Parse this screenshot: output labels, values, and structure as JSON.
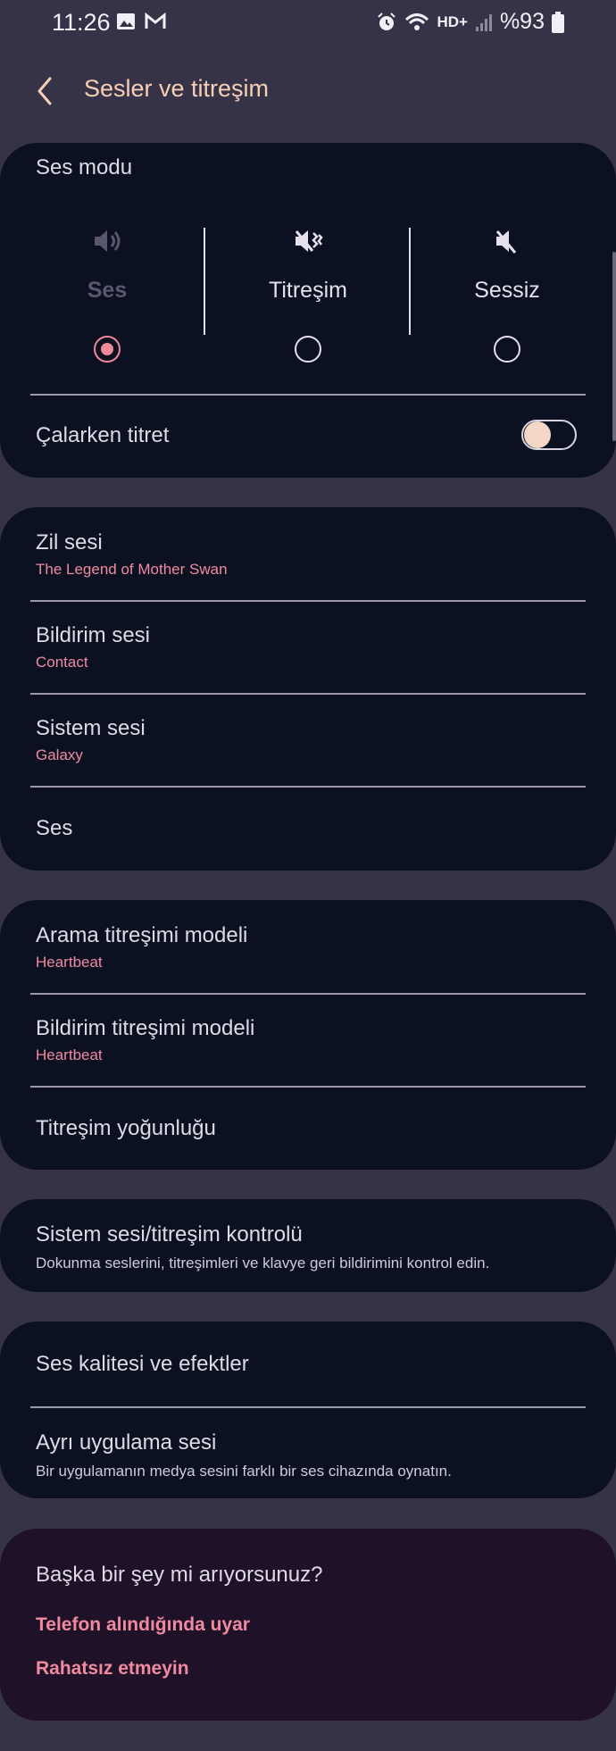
{
  "status_bar": {
    "time": "11:26",
    "network": "HD+",
    "battery": "%93"
  },
  "header": {
    "title": "Sesler ve titreşim"
  },
  "sound_mode": {
    "heading": "Ses modu",
    "options": [
      {
        "label": "Ses",
        "icon": "volume-icon",
        "selected": true
      },
      {
        "label": "Titreşim",
        "icon": "vibrate-icon",
        "selected": false
      },
      {
        "label": "Sessiz",
        "icon": "mute-icon",
        "selected": false
      }
    ],
    "vibrate_while_ringing": {
      "label": "Çalarken titret",
      "enabled": false
    }
  },
  "sounds": [
    {
      "title": "Zil sesi",
      "value": "The Legend of Mother Swan"
    },
    {
      "title": "Bildirim sesi",
      "value": "Contact"
    },
    {
      "title": "Sistem sesi",
      "value": "Galaxy"
    },
    {
      "title": "Ses"
    }
  ],
  "vibration": [
    {
      "title": "Arama titreşimi modeli",
      "value": "Heartbeat"
    },
    {
      "title": "Bildirim titreşimi modeli",
      "value": "Heartbeat"
    },
    {
      "title": "Titreşim yoğunluğu"
    }
  ],
  "system_control": {
    "title": "Sistem sesi/titreşim kontrolü",
    "description": "Dokunma seslerini, titreşimleri ve klavye geri bildirimini kontrol edin."
  },
  "quality": [
    {
      "title": "Ses kalitesi ve efektler"
    },
    {
      "title": "Ayrı uygulama sesi",
      "description": "Bir uygulamanın medya sesini farklı bir ses cihazında oynatın."
    }
  ],
  "suggestions": {
    "heading": "Başka bir şey mi arıyorsunuz?",
    "links": [
      "Telefon alındığında uyar",
      "Rahatsız etmeyin"
    ]
  },
  "colors": {
    "background": "#363348",
    "card": "#0c1122",
    "accent": "#f08aa0",
    "title": "#f6cfb5",
    "suggestion_card": "#1e1128"
  }
}
